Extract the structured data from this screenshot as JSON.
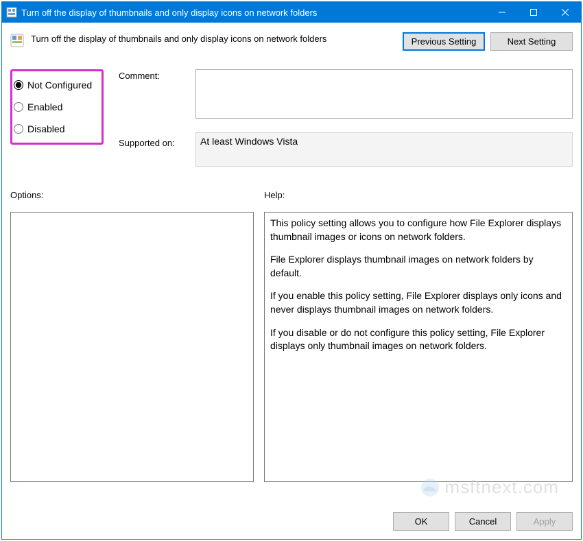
{
  "window": {
    "title": "Turn off the display of thumbnails and only display icons on network folders"
  },
  "header": {
    "policy_title": "Turn off the display of thumbnails and only display icons on network folders",
    "prev_button": "Previous Setting",
    "next_button": "Next Setting"
  },
  "state": {
    "options": [
      {
        "label": "Not Configured"
      },
      {
        "label": "Enabled"
      },
      {
        "label": "Disabled"
      }
    ]
  },
  "labels": {
    "comment": "Comment:",
    "supported": "Supported on:",
    "options": "Options:",
    "help": "Help:"
  },
  "fields": {
    "comment_value": "",
    "supported_value": "At least Windows Vista"
  },
  "help": {
    "p1": "This policy setting allows you to configure how File Explorer displays thumbnail images or icons on network folders.",
    "p2": "File Explorer displays thumbnail images on network folders by default.",
    "p3": "If you enable this policy setting, File Explorer displays only icons and never displays thumbnail images on network folders.",
    "p4": "If you disable or do not configure this policy setting, File Explorer displays only thumbnail images on network folders."
  },
  "buttons": {
    "ok": "OK",
    "cancel": "Cancel",
    "apply": "Apply"
  },
  "watermark": "msftnext.com"
}
